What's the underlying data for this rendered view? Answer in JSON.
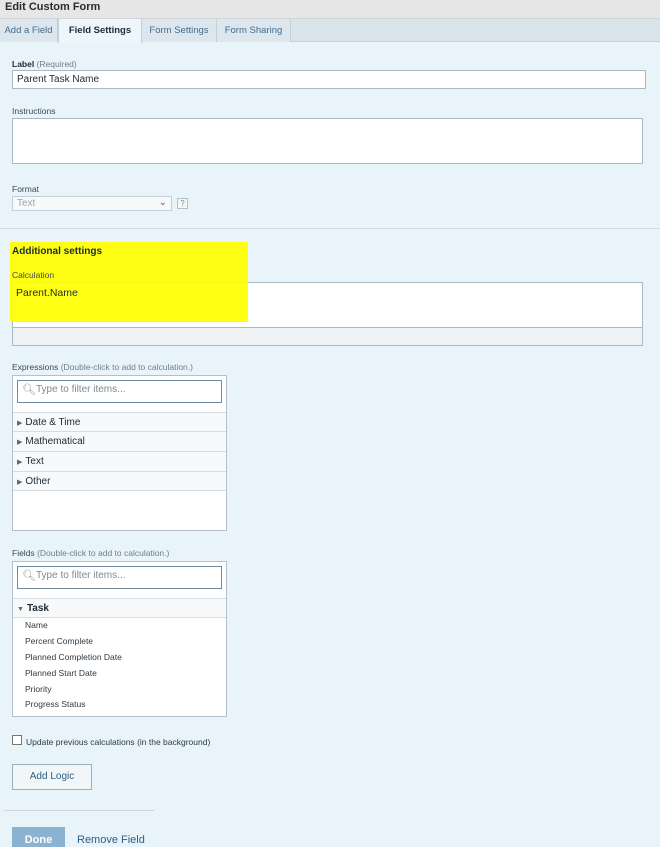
{
  "window": {
    "title": "Edit Custom Form"
  },
  "tabs": [
    {
      "label": "Add a Field"
    },
    {
      "label": "Field Settings"
    },
    {
      "label": "Form Settings"
    },
    {
      "label": "Form Sharing"
    }
  ],
  "label_field": {
    "label": "Label",
    "hint": "(Required)",
    "value": "Parent Task Name"
  },
  "instructions": {
    "label": "Instructions",
    "value": ""
  },
  "format": {
    "label": "Format",
    "selected": "Text",
    "help_icon": "?"
  },
  "additional": {
    "heading": "Additional settings",
    "calc_label": "Calculation",
    "calc_value": "Parent.Name",
    "highlight_color": "#ffff00"
  },
  "expressions": {
    "label": "Expressions",
    "hint": "(Double-click to add to calculation.)",
    "placeholder": "Type to filter items...",
    "categories": [
      "Date & Time",
      "Mathematical",
      "Text",
      "Other"
    ]
  },
  "fields": {
    "label": "Fields",
    "hint": "(Double-click to add to calculation.)",
    "placeholder": "Type to filter items...",
    "group": "Task",
    "items": [
      "Name",
      "Percent Complete",
      "Planned Completion Date",
      "Planned Start Date",
      "Priority",
      "Progress Status"
    ]
  },
  "update_checkbox": {
    "label": "Update previous calculations",
    "hint": "(in the background)"
  },
  "buttons": {
    "add_logic": "Add Logic",
    "done": "Done",
    "remove_field": "Remove Field"
  }
}
